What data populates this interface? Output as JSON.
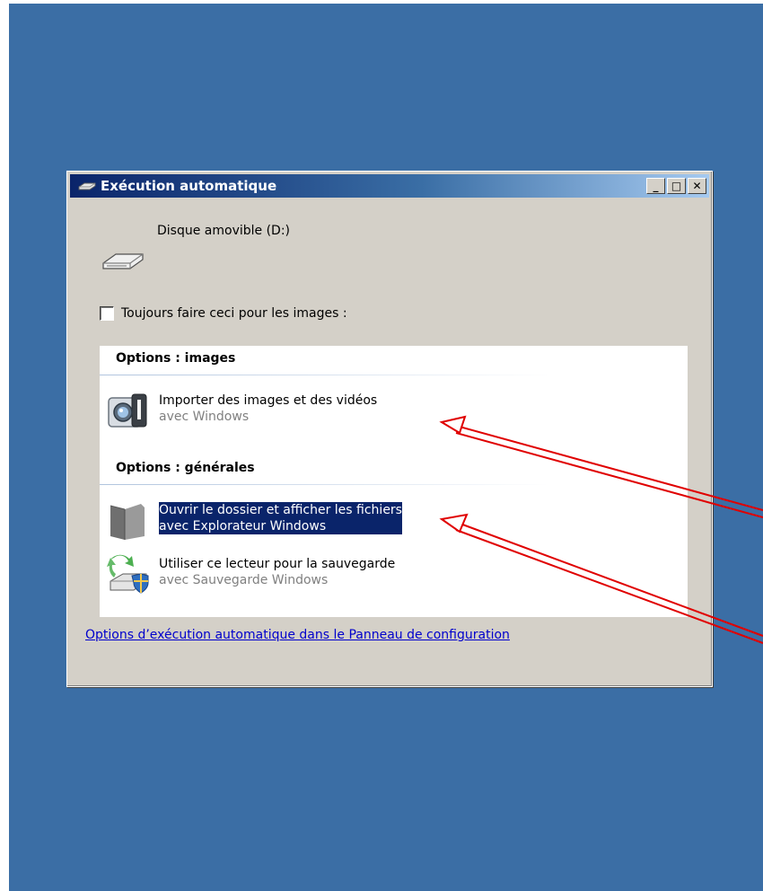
{
  "window": {
    "title": "Exécution automatique",
    "controls": {
      "minimize": "_",
      "maximize": "□",
      "close": "✕"
    }
  },
  "device": {
    "label": "Disque amovible (D:)",
    "icon": "removable-drive-icon"
  },
  "always_checkbox": {
    "label": "Toujours faire ceci pour les images :",
    "checked": false
  },
  "sections": {
    "images": {
      "header": "Options : images",
      "items": [
        {
          "title": "Importer des images et des vidéos",
          "subtitle": "avec Windows",
          "icon": "camera-icon"
        }
      ]
    },
    "general": {
      "header": "Options : générales",
      "items": [
        {
          "title": "Ouvrir le dossier et afficher les fichiers",
          "subtitle": "avec Explorateur Windows",
          "icon": "folder-icon",
          "selected": true
        },
        {
          "title": "Utiliser ce lecteur pour la sauvegarde",
          "subtitle": "avec Sauvegarde Windows",
          "icon": "backup-drive-icon"
        }
      ]
    }
  },
  "control_panel_link": "Options d’exécution automatique dans le Panneau de configuration",
  "colors": {
    "desktop": "#3b6ea5",
    "selection": "#0a246a",
    "annotation_arrow": "#e00000"
  }
}
